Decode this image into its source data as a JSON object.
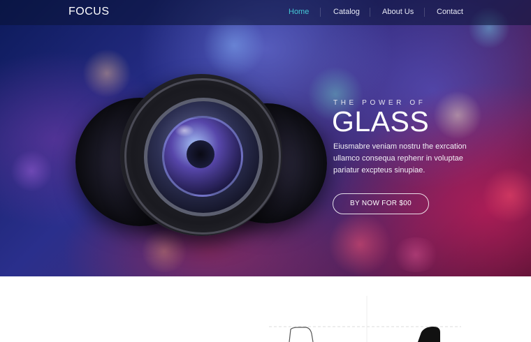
{
  "brand": {
    "logo": "FOCUS"
  },
  "nav": {
    "items": [
      {
        "label": "Home",
        "active": true
      },
      {
        "label": "Catalog",
        "active": false
      },
      {
        "label": "About Us",
        "active": false
      },
      {
        "label": "Contact",
        "active": false
      }
    ]
  },
  "hero": {
    "eyebrow": "THE POWER OF",
    "headline": "GLASS",
    "body_lines": [
      "Eiusmabre veniam nostru the exrcation",
      "ullamco consequa rephenr in voluptae",
      "pariatur excpteus sinupiae."
    ],
    "cta_label": "BY NOW FOR $00"
  },
  "colors": {
    "accent": "#45c9d6",
    "nav_background": "#0a1234",
    "hero_dark": "#0c1a5a",
    "hero_magenta": "#c81e5a"
  }
}
